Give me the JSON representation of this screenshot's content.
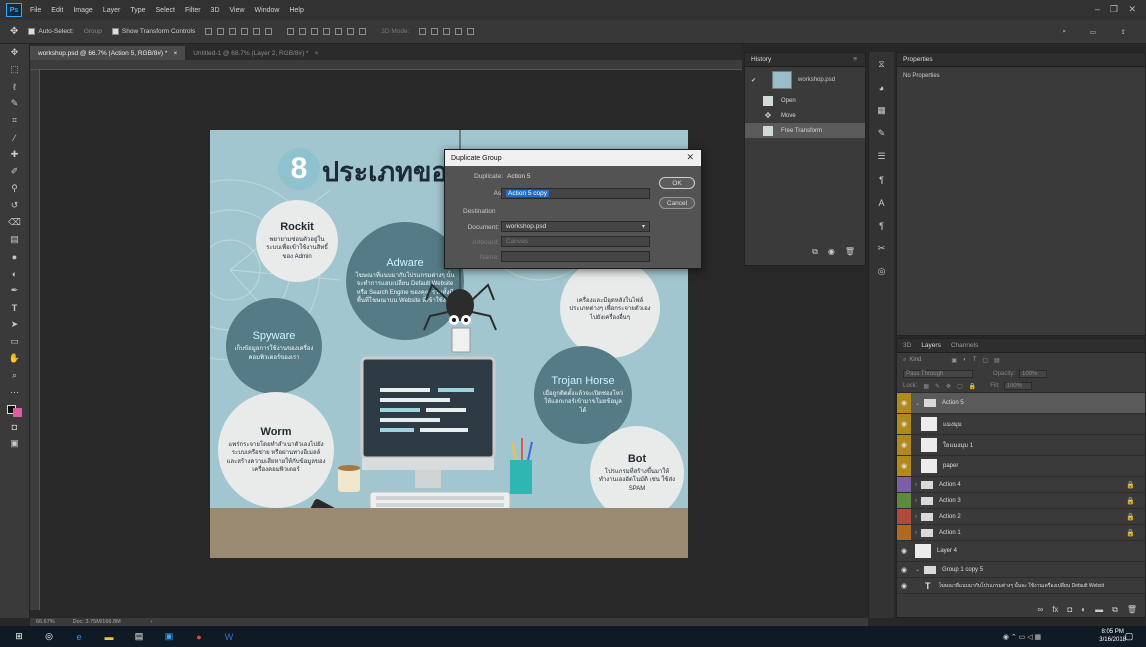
{
  "app": {
    "logo": "Ps",
    "menu": [
      "File",
      "Edit",
      "Image",
      "Layer",
      "Type",
      "Select",
      "Filter",
      "3D",
      "View",
      "Window",
      "Help"
    ]
  },
  "options_bar": {
    "auto_select_label": "Auto-Select:",
    "auto_select_value": "Group",
    "show_transform_label": "Show Transform Controls",
    "mode_3d_label": "3D Mode:"
  },
  "tabs": [
    {
      "label": "workshop.psd @ 66.7% (Action 5, RGB/8#) *",
      "active": true
    },
    {
      "label": "Untitled-1 @ 66.7% (Layer 2, RGB/8#) *",
      "active": false
    }
  ],
  "artboard": {
    "title_number": "8",
    "title_text": "ประเภทของมัลแวร์",
    "bubbles": [
      {
        "title": "Rockit",
        "body": "พยายามซ่อนตัวอยู่ในระบบเพื่อเข้าใช้งานสิทธิ์ของ Admin",
        "style": "light"
      },
      {
        "title": "Adware",
        "body": "โฆษณาที่แนบมากับโปรแกรมต่างๆ นั้นจะทำการแอบเปลี่ยน Default Website หรือ Search Engine ของคุณ รวมทั้งมีพื้นที่โฆษณาบน Website ที่เข้าใช้งาน",
        "style": "dark"
      },
      {
        "title": "Spyware",
        "body": "เก็บข้อมูลการใช้งานของเครื่องคอมพิวเตอร์ของเรา",
        "style": "dark"
      },
      {
        "title": "",
        "body": "เครื่องและมีอุดหลังในไฟล์ประเภทต่างๆ เพื่อกระจายตัวเองไปยังเครื่องอื่นๆ",
        "style": "light"
      },
      {
        "title": "Trojan Horse",
        "body": "เมื่อถูกติดตั้งแล้วจะเปิดช่องโหว่ให้แฮกเกอร์เข้ามาขโมยข้อมูลได้",
        "style": "dark"
      },
      {
        "title": "Worm",
        "body": "แพร่กระจายโดยทำสำเนาตัวเองไปยังระบบเครือข่าย หรือผ่านทางอีเมลล์ และสร้างความเสียหายให้กับข้อมูลของเครื่องคอมพิวเตอร์",
        "style": "light"
      },
      {
        "title": "Bot",
        "body": "โปรแกรมที่สร้างขึ้นมาให้ทำงานเองอัตโนมัติ เช่น ใช้ส่ง SPAM",
        "style": "light"
      }
    ]
  },
  "history_panel": {
    "tab": "History",
    "snapshot": "workshop.psd",
    "items": [
      {
        "label": "Open",
        "selected": false
      },
      {
        "label": "Move",
        "selected": false
      },
      {
        "label": "Free Transform",
        "selected": true
      }
    ]
  },
  "properties_panel": {
    "tab": "Properties",
    "empty_text": "No Properties"
  },
  "layers_panel": {
    "tabs": [
      "3D",
      "Layers",
      "Channels"
    ],
    "search_placeholder": "Kind",
    "blend_mode": "Pass Through",
    "opacity_label": "Opacity:",
    "opacity_value": "100%",
    "lock_label": "Lock:",
    "fill_label": "Fill:",
    "fill_value": "100%",
    "layers": [
      {
        "name": "Action 5",
        "kind": "group",
        "color": "#b08a1a",
        "visible": true,
        "selected": true,
        "indent": 0
      },
      {
        "name": "แมงมุม",
        "kind": "image",
        "color": "#b08a1a",
        "visible": true,
        "selected": false,
        "indent": 1
      },
      {
        "name": "ใยแมงมุม 1",
        "kind": "image",
        "color": "#b08a1a",
        "visible": true,
        "selected": false,
        "indent": 1
      },
      {
        "name": "paper",
        "kind": "image",
        "color": "#b08a1a",
        "visible": true,
        "selected": false,
        "indent": 1
      },
      {
        "name": "Action 4",
        "kind": "group",
        "color": "#7d5fa8",
        "visible": false,
        "selected": false,
        "indent": 0
      },
      {
        "name": "Action 3",
        "kind": "group",
        "color": "#5f8a3d",
        "visible": false,
        "selected": false,
        "indent": 0
      },
      {
        "name": "Action 2",
        "kind": "group",
        "color": "#b04a3a",
        "visible": false,
        "selected": false,
        "indent": 0
      },
      {
        "name": "Action 1",
        "kind": "group",
        "color": "#b06a1f",
        "visible": false,
        "selected": false,
        "indent": 0
      },
      {
        "name": "Layer 4",
        "kind": "image",
        "color": "",
        "visible": true,
        "selected": false,
        "indent": 0
      },
      {
        "name": "Group 1 copy 5",
        "kind": "group",
        "color": "",
        "visible": true,
        "selected": false,
        "indent": 0
      },
      {
        "name": "โฆษณาที่แนบมากับโปรแกรมต่างๆ นั้นจะ ใช้งานเครื่องเปลี่ยน Default Websit",
        "kind": "text",
        "color": "",
        "visible": true,
        "selected": false,
        "indent": 1
      }
    ]
  },
  "dialog": {
    "title": "Duplicate Group",
    "duplicate_label": "Duplicate:",
    "duplicate_value": "Action 5",
    "as_label": "As:",
    "as_value": "Action 5 copy",
    "destination_label": "Destination",
    "document_label": "Document:",
    "document_value": "workshop.psd",
    "artboard_label": "Artboard:",
    "artboard_value": "Canvas",
    "name_label": "Name:",
    "ok_label": "OK",
    "cancel_label": "Cancel"
  },
  "status_bar": {
    "zoom": "66.67%",
    "doc_info": "Doc: 3.75M/166.8M"
  },
  "taskbar": {
    "time": "8:05 PM",
    "date": "3/16/2018"
  }
}
